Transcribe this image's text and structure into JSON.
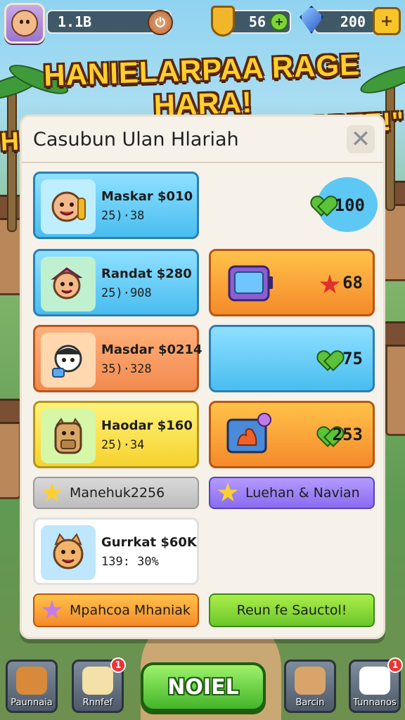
{
  "hud": {
    "level_text": "1.1B",
    "shield_count": "56",
    "gem_count": "200"
  },
  "banner": {
    "line1": "HANIELARPAA RAGE HARA!",
    "line2": "HADGIJK KONAHH MAARREE!\""
  },
  "panel": {
    "title": "Casubun Ulan Hlariah"
  },
  "cards": [
    {
      "name": "Maskar $010",
      "sub": "25)·38"
    },
    {
      "name": "Randat $280",
      "sub": "25)·908"
    },
    {
      "name": "Masdar $0214",
      "sub": "35)·328"
    },
    {
      "name": "Haodar $160",
      "sub": "25)·34"
    },
    {
      "name": "Gurrkat $60K",
      "sub": "139: 30%"
    }
  ],
  "rewards": [
    {
      "value": "100"
    },
    {
      "value": "68"
    },
    {
      "value": "75"
    },
    {
      "value": "253"
    }
  ],
  "bars": {
    "grey": "Manehuk2256",
    "purple": "Luehan & Navian",
    "orange": "Mpahcoa Mhaniak",
    "green": "Reun fe Sauctol!"
  },
  "nav": {
    "item1": "Paunnaia",
    "item2": "Rnnfef",
    "main_button": "NOIEL",
    "item3": "Barcin",
    "item4": "Tunnanos",
    "badge2": "1",
    "badge4": "1"
  },
  "colors": {
    "card_blue": "#49bdf0",
    "card_orange": "#f58a2a",
    "card_yellow": "#f6d22e",
    "button_green": "#44b52a",
    "accent_purple": "#8a6cf0"
  },
  "icons": [
    "avatar",
    "shield-icon",
    "gem-icon",
    "plus-icon",
    "close-icon",
    "heart-icon",
    "star-icon"
  ]
}
